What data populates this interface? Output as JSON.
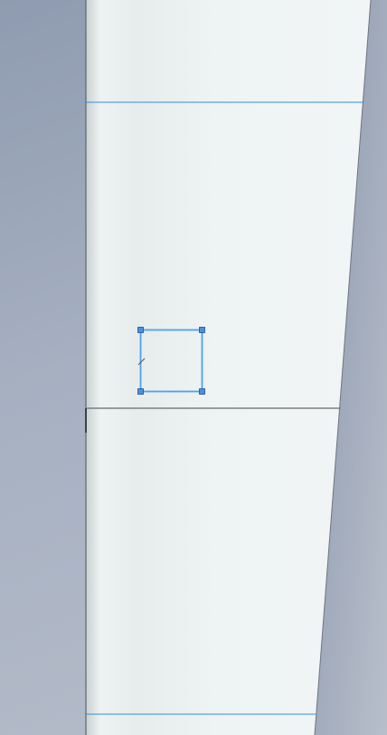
{
  "viewport": {
    "background_color": "#a6b0c1",
    "part_face_color": "#eef3f3",
    "edge_color": "#808080",
    "sketch_line_color": "#2f8fd8",
    "selection_color": "#4aa3f0",
    "handle_color": "#4a90e2",
    "handle_border_color": "#1c4f8a"
  },
  "sketch": {
    "shape": "rectangle",
    "state": "selected",
    "handle_count": 4
  }
}
